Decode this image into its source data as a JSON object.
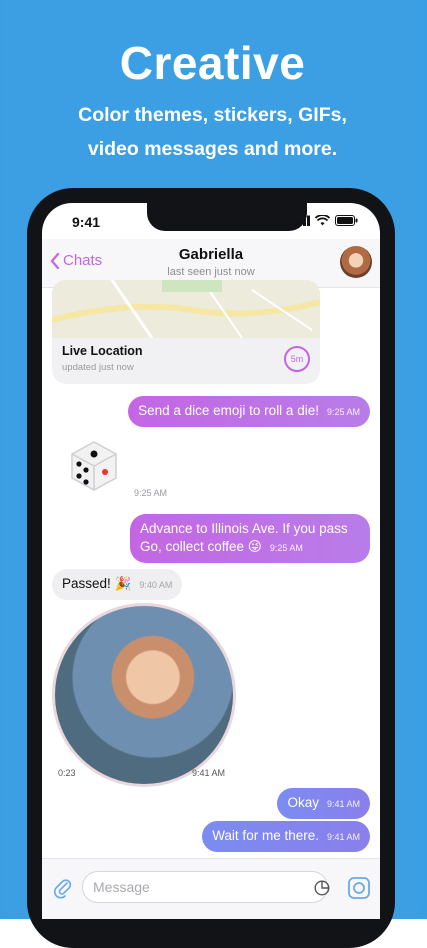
{
  "promo": {
    "title": "Creative",
    "subtitle_line1": "Color themes, stickers, GIFs,",
    "subtitle_line2": "video messages and more."
  },
  "status_bar": {
    "time": "9:41"
  },
  "chat_header": {
    "back_label": "Chats",
    "name": "Gabriella",
    "status": "last seen just now"
  },
  "live_location": {
    "title": "Live Location",
    "subtitle": "updated just now",
    "timer": "5m"
  },
  "messages": [
    {
      "text": "Send a dice emoji to roll a die!",
      "time": "9:25 AM"
    },
    {
      "sticker": "dice",
      "time": "9:25 AM"
    },
    {
      "text": "Advance to Illinois Ave. If you pass Go, collect coffee 😜",
      "time": "9:25 AM"
    },
    {
      "text": "Passed! 🎉",
      "time": "9:40 AM"
    },
    {
      "video_duration": "0:23",
      "time": "9:41 AM"
    },
    {
      "text": "Okay",
      "time": "9:41 AM"
    },
    {
      "text": "Wait for me there.",
      "time": "9:41 AM"
    }
  ],
  "composer": {
    "placeholder": "Message"
  },
  "colors": {
    "accent": "#c565e0",
    "background": "#3c9fe3"
  }
}
